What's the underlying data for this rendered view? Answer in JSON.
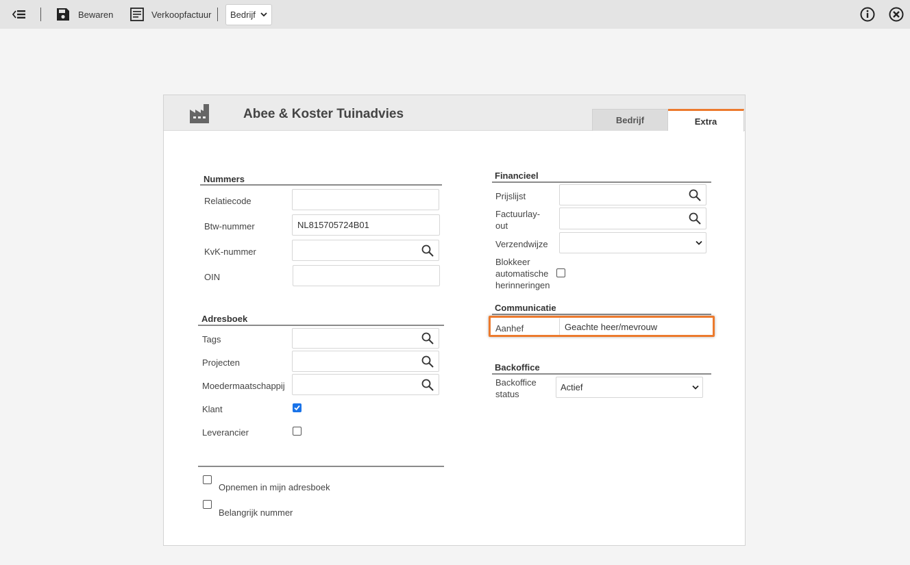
{
  "toolbar": {
    "back_icon": "back-list-icon",
    "save_label": "Bewaren",
    "invoice_label": "Verkoopfactuur",
    "type_select_value": "Bedrijf",
    "info_icon": "info-icon",
    "close_icon": "close-circle-icon"
  },
  "header": {
    "company_icon": "factory-icon",
    "title": "Abee & Koster Tuinadvies",
    "tabs": [
      {
        "label": "Bedrijf",
        "active": false
      },
      {
        "label": "Extra",
        "active": true
      }
    ]
  },
  "left": {
    "nummers": {
      "title": "Nummers",
      "relatiecode": {
        "label": "Relatiecode",
        "value": ""
      },
      "btw": {
        "label": "Btw-nummer",
        "value": "NL815705724B01"
      },
      "kvk": {
        "label": "KvK-nummer",
        "value": ""
      },
      "oin": {
        "label": "OIN",
        "value": ""
      }
    },
    "adresboek": {
      "title": "Adresboek",
      "tags": {
        "label": "Tags",
        "value": ""
      },
      "projecten": {
        "label": "Projecten",
        "value": ""
      },
      "moeder": {
        "label": "Moedermaatschappij",
        "value": ""
      },
      "klant": {
        "label": "Klant",
        "checked": true
      },
      "leverancier": {
        "label": "Leverancier",
        "checked": false
      }
    },
    "footer": {
      "opnemen": {
        "label": "Opnemen in mijn adresboek",
        "checked": false
      },
      "belangrijk": {
        "label": "Belangrijk nummer",
        "checked": false
      }
    }
  },
  "right": {
    "financieel": {
      "title": "Financieel",
      "prijslijst": {
        "label": "Prijslijst",
        "value": ""
      },
      "factuurlayout": {
        "label_line1": "Factuurlay-",
        "label_line2": "out",
        "value": ""
      },
      "verzendwijze": {
        "label": "Verzendwijze",
        "value": ""
      },
      "blokkeer": {
        "label_line1": "Blokkeer",
        "label_line2": "automatische",
        "label_line3": "herinneringen",
        "checked": false
      }
    },
    "communicatie": {
      "title": "Communicatie",
      "aanhef": {
        "label": "Aanhef",
        "value": "Geachte heer/mevrouw"
      }
    },
    "backoffice": {
      "title": "Backoffice",
      "status": {
        "label_line1": "Backoffice",
        "label_line2": "status",
        "value": "Actief"
      }
    }
  },
  "colors": {
    "accent": "#ec7a2d",
    "checkbox_checked": "#1a73e8"
  }
}
